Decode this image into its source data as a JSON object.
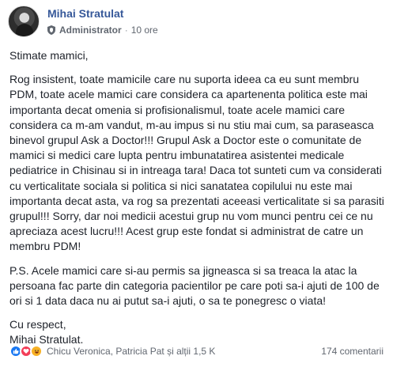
{
  "author": {
    "name": "Mihai Stratulat",
    "role": "Administrator",
    "time": "10 ore",
    "separator": "·"
  },
  "post": {
    "paragraphs": [
      "Stimate mamici,",
      "Rog insistent, toate mamicile care nu suporta ideea ca eu sunt membru PDM, toate acele mamici care considera ca apartenenta politica este mai importanta decat omenia si profisionalismul, toate acele mamici care considera ca m-am vandut, m-au impus si nu stiu mai cum, sa paraseasca binevol grupul Ask a Doctor!!! Grupul Ask a Doctor este o comunitate de mamici si medici care lupta pentru imbunatatirea asistentei medicale pediatrice in Chisinau si in intreaga tara! Daca tot sunteti cum va considerati cu verticalitate sociala si politica si nici sanatatea copilului nu este mai importanta decat asta, va rog sa prezentati aceeasi verticalitate si sa parasiti grupul!!! Sorry, dar noi medicii acestui grup nu vom munci pentru cei ce nu apreciaza acest lucru!!! Acest grup este fondat si administrat de catre un membru PDM!",
      "P.S. Acele mamici care si-au permis sa jigneasca si sa treaca la atac la persoana fac parte din categoria pacientilor pe care poti sa-i ajuti de 100 de ori si 1 data daca nu ai putut sa-i ajuti, o sa te ponegresc o viata!",
      "Cu respect,",
      "Mihai Stratulat."
    ]
  },
  "footer": {
    "reactors": "Chicu Veronica, Patricia Pat și alții 1,5 K",
    "comments": "174 comentarii",
    "reaction_icons": [
      "like-icon",
      "love-icon",
      "haha-icon"
    ]
  },
  "colors": {
    "name": "#365899",
    "meta": "#616770",
    "text": "#1d2129",
    "like": "#1877f2",
    "love": "#f33e58",
    "haha": "#f7b125"
  }
}
